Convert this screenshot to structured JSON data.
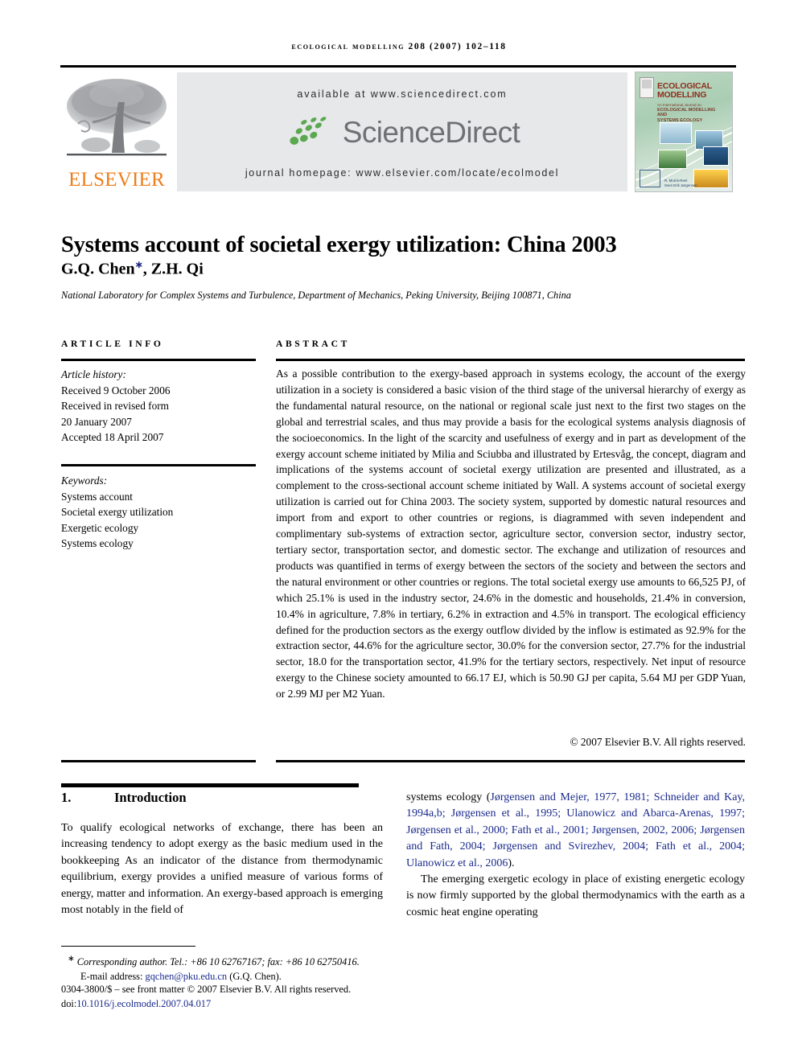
{
  "running_head": "ECOLOGICAL MODELLING 208 (2007) 102–118",
  "header": {
    "available_at": "available at www.sciencedirect.com",
    "journal_homepage": "journal homepage: www.elsevier.com/locate/ecolmodel",
    "sciencedirect_wordmark": "ScienceDirect",
    "publisher_logo_text": "ELSEVIER",
    "band_color": "#e7e8ea",
    "sciencedirect_green": "#5aa84f",
    "sciencedirect_gray": "#6e7073",
    "elsevier_orange": "#ef7d1a"
  },
  "cover": {
    "title_line1": "ECOLOGICAL",
    "title_line2": "MODELLING",
    "subtitle_line1": "An International Journal on",
    "subtitle_line2": "ECOLOGICAL MODELLING AND",
    "subtitle_line3": "SYSTEMS ECOLOGY",
    "editors_line1": "R. Morris-Reel",
    "editors_line2": "Sven Erik Jørgensen"
  },
  "article": {
    "title": "Systems account of societal exergy utilization: China 2003",
    "authors": "G.Q. Chen",
    "authors_rest": ", Z.H. Qi",
    "corresponding_marker": "∗",
    "affiliation": "National Laboratory for Complex Systems and Turbulence, Department of Mechanics, Peking University, Beijing 100871, China"
  },
  "article_info": {
    "heading": "ARTICLE INFO",
    "history_label": "Article history:",
    "received": "Received 9 October 2006",
    "revised_label": "Received in revised form",
    "revised_date": "20 January 2007",
    "accepted": "Accepted 18 April 2007",
    "keywords_label": "Keywords:",
    "keywords": [
      "Systems account",
      "Societal exergy utilization",
      "Exergetic ecology",
      "Systems ecology"
    ]
  },
  "abstract": {
    "heading": "ABSTRACT",
    "text": "As a possible contribution to the exergy-based approach in systems ecology, the account of the exergy utilization in a society is considered a basic vision of the third stage of the universal hierarchy of exergy as the fundamental natural resource, on the national or regional scale just next to the first two stages on the global and terrestrial scales, and thus may provide a basis for the ecological systems analysis diagnosis of the socioeconomics. In the light of the scarcity and usefulness of exergy and in part as development of the exergy account scheme initiated by Milia and Sciubba and illustrated by Ertesvåg, the concept, diagram and implications of the systems account of societal exergy utilization are presented and illustrated, as a complement to the cross-sectional account scheme initiated by Wall. A systems account of societal exergy utilization is carried out for China 2003. The society system, supported by domestic natural resources and import from and export to other countries or regions, is diagrammed with seven independent and complimentary sub-systems of extraction sector, agriculture sector, conversion sector, industry sector, tertiary sector, transportation sector, and domestic sector. The exchange and utilization of resources and products was quantified in terms of exergy between the sectors of the society and between the sectors and the natural environment or other countries or regions. The total societal exergy use amounts to 66,525 PJ, of which 25.1% is used in the industry sector, 24.6% in the domestic and households, 21.4% in conversion, 10.4% in agriculture, 7.8% in tertiary, 6.2% in extraction and 4.5% in transport. The ecological efficiency defined for the production sectors as the exergy outflow divided by the inflow is estimated as 92.9% for the extraction sector, 44.6% for the agriculture sector, 30.0% for the conversion sector, 27.7% for the industrial sector, 18.0 for the transportation sector, 41.9% for the tertiary sectors, respectively. Net input of resource exergy to the Chinese society amounted to 66.17 EJ, which is 50.90 GJ per capita, 5.64 MJ per GDP Yuan, or 2.99 MJ per M2 Yuan.",
    "copyright": "© 2007 Elsevier B.V. All rights reserved."
  },
  "body": {
    "section_number": "1.",
    "section_title": "Introduction",
    "left_column": "To qualify ecological networks of exchange, there has been an increasing tendency to adopt exergy as the basic medium used in the bookkeeping As an indicator of the distance from thermodynamic equilibrium, exergy provides a unified measure of various forms of energy, matter and information. An exergy-based approach is emerging most notably in the field of",
    "right_para1_pre": "systems ecology (",
    "right_para1_cite": "Jørgensen and Mejer, 1977, 1981; Schneider and Kay, 1994a,b; Jørgensen et al., 1995; Ulanowicz and Abarca-Arenas, 1997; Jørgensen et al., 2000; Fath et al., 2001; Jørgensen, 2002, 2006; Jørgensen and Fath, 2004; Jørgensen and Svirezhev, 2004; Fath et al., 2004; Ulanowicz et al., 2006",
    "right_para1_post": ").",
    "right_para2": "The emerging exergetic ecology in place of existing energetic ecology is now firmly supported by the global thermodynamics with the earth as a cosmic heat engine operating"
  },
  "footnotes": {
    "corresponding_marker": "∗",
    "corresponding": "Corresponding author. Tel.: +86 10 62767167; fax: +86 10 62750416.",
    "email_label": "E-mail address:",
    "email": "gqchen@pku.edu.cn",
    "email_owner": "(G.Q. Chen).",
    "front_matter": "0304-3800/$ – see front matter © 2007 Elsevier B.V. All rights reserved.",
    "doi_label": "doi:",
    "doi": "10.1016/j.ecolmodel.2007.04.017"
  }
}
